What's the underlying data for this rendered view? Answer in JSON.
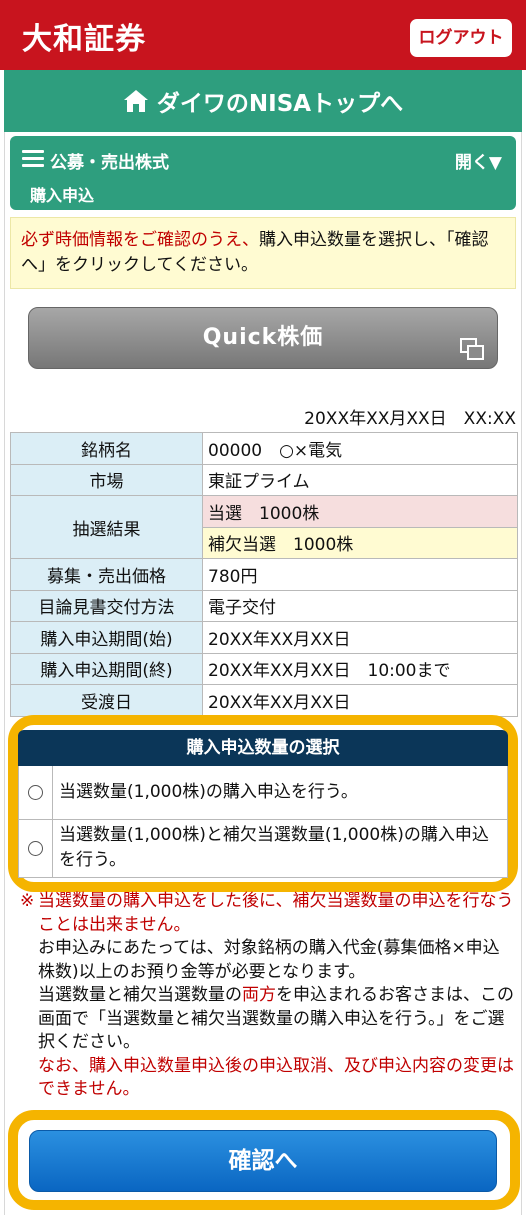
{
  "header": {
    "brand": "大和証券",
    "logout_label": "ログアウト"
  },
  "nisa_nav": {
    "label": "ダイワのNISAトップへ",
    "icon": "home-icon"
  },
  "accordion": {
    "title": "公募・売出株式",
    "toggle": "開く▼",
    "subtitle": "購入申込",
    "icon": "menu-icon"
  },
  "notice": {
    "red_text": "必ず時価情報をご確認のうえ、",
    "text": "購入申込数量を選択し、「確認へ」をクリックしてください。"
  },
  "quick_button": {
    "label": "Quick株価",
    "icon": "new-window-icon"
  },
  "datetime": "20XX年XX月XX日　XX:XX",
  "info_table": {
    "rows": [
      {
        "label": "銘柄名",
        "value": "00000　○×電気"
      },
      {
        "label": "市場",
        "value": "東証プライム"
      },
      {
        "label": "抽選結果",
        "value": "当選　1000株",
        "value2": "補欠当選　1000株"
      },
      {
        "label": "募集・売出価格",
        "value": "780円"
      },
      {
        "label": "目論見書交付方法",
        "value": "電子交付"
      },
      {
        "label": "購入申込期間(始)",
        "value": "20XX年XX月XX日"
      },
      {
        "label": "購入申込期間(終)",
        "value": "20XX年XX月XX日　10:00まで"
      },
      {
        "label": "受渡日",
        "value": "20XX年XX月XX日"
      }
    ]
  },
  "quantity_selection": {
    "title": "購入申込数量の選択",
    "options": [
      {
        "label": "当選数量(1,000株)の購入申込を行う。",
        "selected": false
      },
      {
        "label": "当選数量(1,000株)と補欠当選数量(1,000株)の購入申込を行う。",
        "selected": false
      }
    ]
  },
  "notes": {
    "mark": "※",
    "red_1": "当選数量の購入申込をした後に、補欠当選数量の申込を行なうことは出来ません。",
    "text_1": "お申込みにあたっては、対象銘柄の購入代金(募集価格×申込株数)以上のお預り金等が必要となります。",
    "text_2a": "当選数量と補欠当選数量の",
    "red_2": "両方",
    "text_2b": "を申込まれるお客さまは、この画面で「当選数量と補欠当選数量の購入申込を行う。」をご選択ください。",
    "red_3": "なお、購入申込数量申込後の申込取消、及び申込内容の変更はできません。"
  },
  "confirm_button": {
    "label": "確認へ"
  },
  "colors": {
    "header_red": "#c8141e",
    "nisa_green": "#2e9e7e",
    "highlight": "#f5b400",
    "confirm_blue": "#0a66c2",
    "table_head": "#0b3658"
  }
}
